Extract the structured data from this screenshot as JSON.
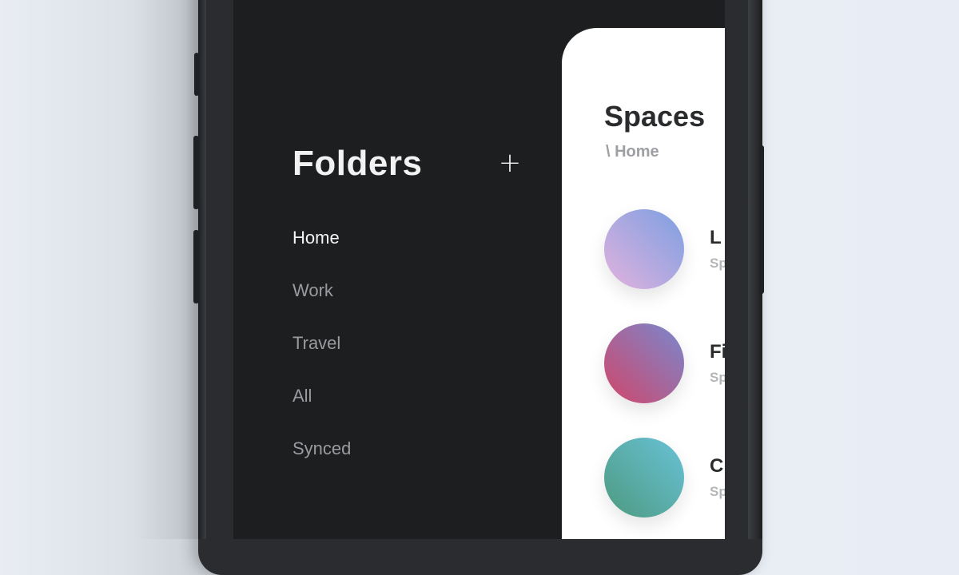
{
  "sidebar": {
    "title": "Folders",
    "add_label": "+",
    "items": [
      {
        "label": "Home",
        "active": true
      },
      {
        "label": "Work",
        "active": false
      },
      {
        "label": "Travel",
        "active": false
      },
      {
        "label": "All",
        "active": false
      },
      {
        "label": "Synced",
        "active": false
      }
    ]
  },
  "panel": {
    "title": "Spaces",
    "breadcrumb": "\\ Home",
    "spaces": [
      {
        "name": "L",
        "subtitle": "Sp",
        "gradient": [
          "#e3b2de",
          "#7b9fe2"
        ]
      },
      {
        "name": "Fi",
        "subtitle": "Sp",
        "gradient": [
          "#d1466a",
          "#7889cf"
        ]
      },
      {
        "name": "C",
        "subtitle": "Sp",
        "gradient": [
          "#4d9a80",
          "#69c2d7"
        ]
      }
    ]
  },
  "colors": {
    "screen_bg": "#1d1e20",
    "active_text": "#f4f4f4",
    "inactive_text": "#9a9b9e",
    "panel_bg": "#ffffff"
  }
}
